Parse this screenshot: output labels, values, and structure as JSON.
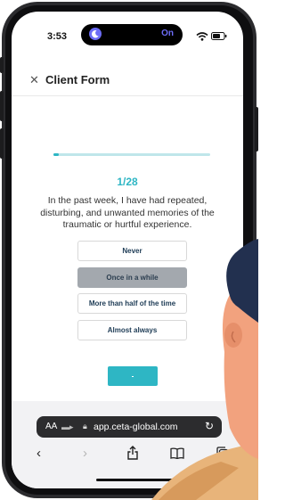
{
  "status_bar": {
    "time": "3:53",
    "focus_label": "On",
    "focus_color": "#6c6cf5"
  },
  "header": {
    "close_icon": "close-icon",
    "title": "Client Form"
  },
  "progress": {
    "current": 1,
    "total": 28,
    "label": "1/28",
    "color": "#2eb6c4"
  },
  "question": {
    "text": "In the past week, I have had repeated, disturbing, and unwanted memories of the traumatic or hurtful experience."
  },
  "options": [
    {
      "label": "Never",
      "selected": false
    },
    {
      "label": "Once in a while",
      "selected": true
    },
    {
      "label": "More than half of the time",
      "selected": false
    },
    {
      "label": "Almost always",
      "selected": false
    }
  ],
  "next_button": {
    "label": ".",
    "color": "#2eb6c4"
  },
  "browser": {
    "text_size_label": "AA",
    "url": "app.ceta-global.com"
  },
  "toolbar": {
    "icons": [
      "back-icon",
      "forward-icon",
      "share-icon",
      "bookmarks-icon",
      "tabs-icon"
    ]
  }
}
